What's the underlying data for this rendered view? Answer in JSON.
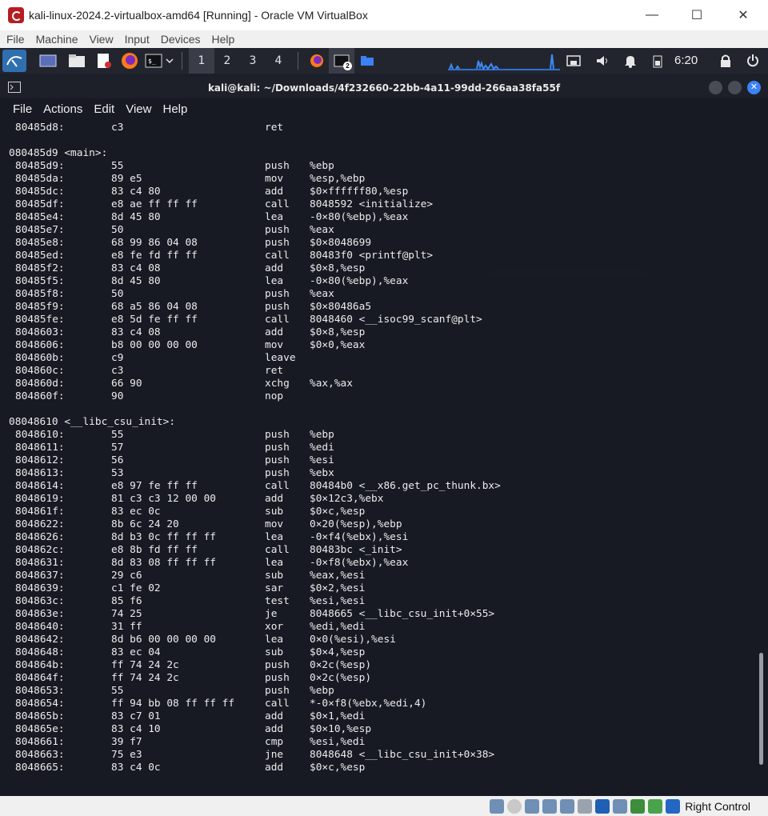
{
  "window": {
    "title": "kali-linux-2024.2-virtualbox-amd64 [Running] - Oracle VM VirtualBox",
    "controls": [
      "—",
      "☐",
      "✕"
    ]
  },
  "vbox_menu": [
    "File",
    "Machine",
    "View",
    "Input",
    "Devices",
    "Help"
  ],
  "panel": {
    "workspaces": [
      "1",
      "2",
      "3",
      "4"
    ],
    "badge": "2",
    "clock": "6:20"
  },
  "terminal": {
    "title": "kali@kali: ~/Downloads/4f232660-22bb-4a11-99dd-266aa38fa55f",
    "menu": [
      "File",
      "Actions",
      "Edit",
      "View",
      "Help"
    ],
    "lines": [
      {
        "addr": "80485d8:",
        "bytes": "c3",
        "mnem": "ret",
        "ops": ""
      },
      {
        "label": ""
      },
      {
        "label": "080485d9 <main>:"
      },
      {
        "addr": "80485d9:",
        "bytes": "55",
        "mnem": "push",
        "ops": "%ebp"
      },
      {
        "addr": "80485da:",
        "bytes": "89 e5",
        "mnem": "mov",
        "ops": "%esp,%ebp"
      },
      {
        "addr": "80485dc:",
        "bytes": "83 c4 80",
        "mnem": "add",
        "ops": "$0×ffffff80,%esp"
      },
      {
        "addr": "80485df:",
        "bytes": "e8 ae ff ff ff",
        "mnem": "call",
        "ops": "8048592 <initialize>"
      },
      {
        "addr": "80485e4:",
        "bytes": "8d 45 80",
        "mnem": "lea",
        "ops": "-0×80(%ebp),%eax"
      },
      {
        "addr": "80485e7:",
        "bytes": "50",
        "mnem": "push",
        "ops": "%eax"
      },
      {
        "addr": "80485e8:",
        "bytes": "68 99 86 04 08",
        "mnem": "push",
        "ops": "$0×8048699"
      },
      {
        "addr": "80485ed:",
        "bytes": "e8 fe fd ff ff",
        "mnem": "call",
        "ops": "80483f0 <printf@plt>"
      },
      {
        "addr": "80485f2:",
        "bytes": "83 c4 08",
        "mnem": "add",
        "ops": "$0×8,%esp"
      },
      {
        "addr": "80485f5:",
        "bytes": "8d 45 80",
        "mnem": "lea",
        "ops": "-0×80(%ebp),%eax"
      },
      {
        "addr": "80485f8:",
        "bytes": "50",
        "mnem": "push",
        "ops": "%eax"
      },
      {
        "addr": "80485f9:",
        "bytes": "68 a5 86 04 08",
        "mnem": "push",
        "ops": "$0×80486a5"
      },
      {
        "addr": "80485fe:",
        "bytes": "e8 5d fe ff ff",
        "mnem": "call",
        "ops": "8048460 <__isoc99_scanf@plt>"
      },
      {
        "addr": "8048603:",
        "bytes": "83 c4 08",
        "mnem": "add",
        "ops": "$0×8,%esp"
      },
      {
        "addr": "8048606:",
        "bytes": "b8 00 00 00 00",
        "mnem": "mov",
        "ops": "$0×0,%eax"
      },
      {
        "addr": "804860b:",
        "bytes": "c9",
        "mnem": "leave",
        "ops": ""
      },
      {
        "addr": "804860c:",
        "bytes": "c3",
        "mnem": "ret",
        "ops": ""
      },
      {
        "addr": "804860d:",
        "bytes": "66 90",
        "mnem": "xchg",
        "ops": "%ax,%ax"
      },
      {
        "addr": "804860f:",
        "bytes": "90",
        "mnem": "nop",
        "ops": ""
      },
      {
        "label": ""
      },
      {
        "label": "08048610 <__libc_csu_init>:"
      },
      {
        "addr": "8048610:",
        "bytes": "55",
        "mnem": "push",
        "ops": "%ebp"
      },
      {
        "addr": "8048611:",
        "bytes": "57",
        "mnem": "push",
        "ops": "%edi"
      },
      {
        "addr": "8048612:",
        "bytes": "56",
        "mnem": "push",
        "ops": "%esi"
      },
      {
        "addr": "8048613:",
        "bytes": "53",
        "mnem": "push",
        "ops": "%ebx"
      },
      {
        "addr": "8048614:",
        "bytes": "e8 97 fe ff ff",
        "mnem": "call",
        "ops": "80484b0 <__x86.get_pc_thunk.bx>"
      },
      {
        "addr": "8048619:",
        "bytes": "81 c3 c3 12 00 00",
        "mnem": "add",
        "ops": "$0×12c3,%ebx"
      },
      {
        "addr": "804861f:",
        "bytes": "83 ec 0c",
        "mnem": "sub",
        "ops": "$0×c,%esp"
      },
      {
        "addr": "8048622:",
        "bytes": "8b 6c 24 20",
        "mnem": "mov",
        "ops": "0×20(%esp),%ebp"
      },
      {
        "addr": "8048626:",
        "bytes": "8d b3 0c ff ff ff",
        "mnem": "lea",
        "ops": "-0×f4(%ebx),%esi"
      },
      {
        "addr": "804862c:",
        "bytes": "e8 8b fd ff ff",
        "mnem": "call",
        "ops": "80483bc <_init>"
      },
      {
        "addr": "8048631:",
        "bytes": "8d 83 08 ff ff ff",
        "mnem": "lea",
        "ops": "-0×f8(%ebx),%eax"
      },
      {
        "addr": "8048637:",
        "bytes": "29 c6",
        "mnem": "sub",
        "ops": "%eax,%esi"
      },
      {
        "addr": "8048639:",
        "bytes": "c1 fe 02",
        "mnem": "sar",
        "ops": "$0×2,%esi"
      },
      {
        "addr": "804863c:",
        "bytes": "85 f6",
        "mnem": "test",
        "ops": "%esi,%esi"
      },
      {
        "addr": "804863e:",
        "bytes": "74 25",
        "mnem": "je",
        "ops": "8048665 <__libc_csu_init+0×55>"
      },
      {
        "addr": "8048640:",
        "bytes": "31 ff",
        "mnem": "xor",
        "ops": "%edi,%edi"
      },
      {
        "addr": "8048642:",
        "bytes": "8d b6 00 00 00 00",
        "mnem": "lea",
        "ops": "0×0(%esi),%esi"
      },
      {
        "addr": "8048648:",
        "bytes": "83 ec 04",
        "mnem": "sub",
        "ops": "$0×4,%esp"
      },
      {
        "addr": "804864b:",
        "bytes": "ff 74 24 2c",
        "mnem": "push",
        "ops": "0×2c(%esp)"
      },
      {
        "addr": "804864f:",
        "bytes": "ff 74 24 2c",
        "mnem": "push",
        "ops": "0×2c(%esp)"
      },
      {
        "addr": "8048653:",
        "bytes": "55",
        "mnem": "push",
        "ops": "%ebp"
      },
      {
        "addr": "8048654:",
        "bytes": "ff 94 bb 08 ff ff ff",
        "mnem": "call",
        "ops": "*-0×f8(%ebx,%edi,4)"
      },
      {
        "addr": "804865b:",
        "bytes": "83 c7 01",
        "mnem": "add",
        "ops": "$0×1,%edi"
      },
      {
        "addr": "804865e:",
        "bytes": "83 c4 10",
        "mnem": "add",
        "ops": "$0×10,%esp"
      },
      {
        "addr": "8048661:",
        "bytes": "39 f7",
        "mnem": "cmp",
        "ops": "%esi,%edi"
      },
      {
        "addr": "8048663:",
        "bytes": "75 e3",
        "mnem": "jne",
        "ops": "8048648 <__libc_csu_init+0×38>"
      },
      {
        "addr": "8048665:",
        "bytes": "83 c4 0c",
        "mnem": "add",
        "ops": "$0×c,%esp"
      }
    ]
  },
  "statusbar": {
    "host_key": "Right Control"
  },
  "colors": {
    "accent": "#3b82f6",
    "terminal_bg": "#181a22",
    "panel_bg": "#23252e"
  }
}
